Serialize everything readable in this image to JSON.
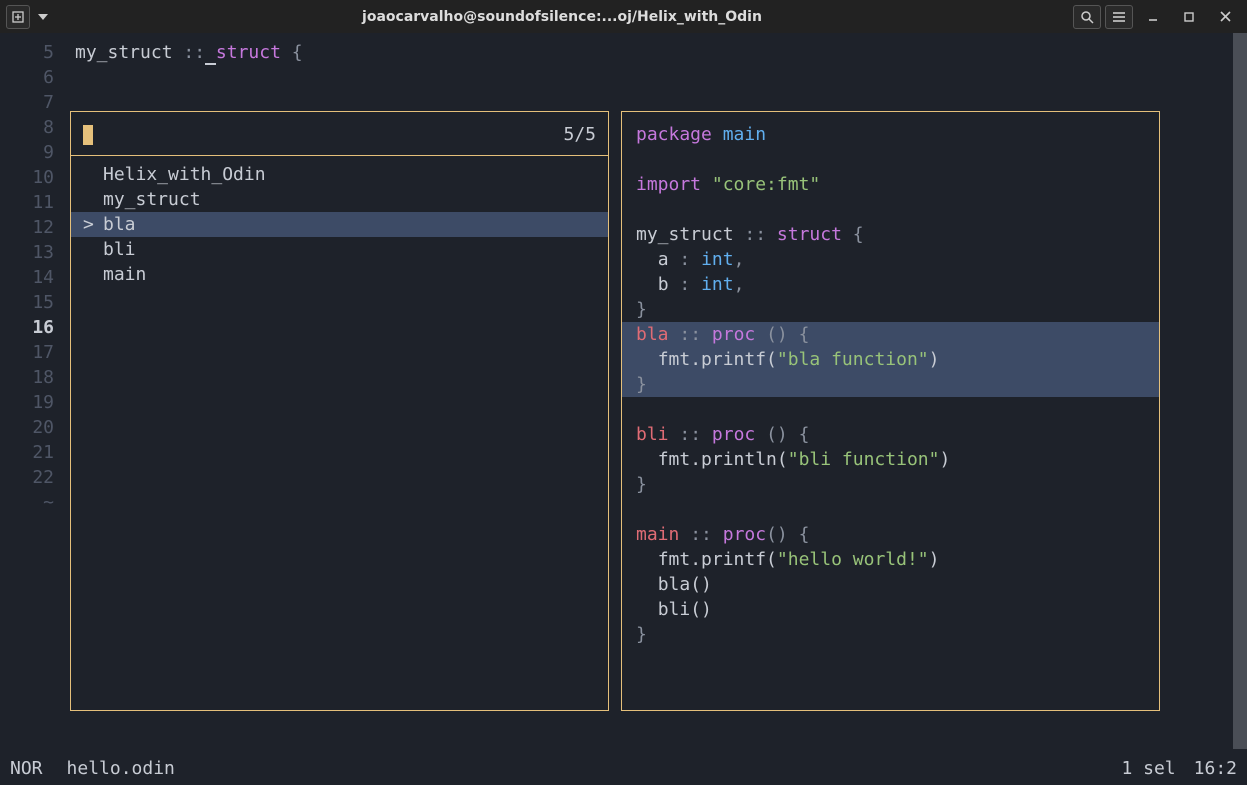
{
  "titlebar": {
    "title": "joaocarvalho@soundofsilence:...oj/Helix_with_Odin"
  },
  "gutter": {
    "lines": [
      "5",
      "6",
      "7",
      "8",
      "9",
      "10",
      "11",
      "12",
      "13",
      "14",
      "15",
      "16",
      "17",
      "18",
      "19",
      "20",
      "21",
      "22",
      "~"
    ],
    "current": "16"
  },
  "bgcode": {
    "ident": "my_struct",
    "sep": "::",
    "kw": "struct",
    "brace": "{"
  },
  "picker": {
    "count": "5/5",
    "items": [
      "Helix_with_Odin",
      "my_struct",
      "bla",
      "bli",
      "main"
    ],
    "selected": "bla"
  },
  "preview": {
    "package_kw": "package",
    "package_name": "main",
    "import_kw": "import",
    "import_str": "\"core:fmt\"",
    "struct_name": "my_struct",
    "struct_sep": "::",
    "struct_kw": "struct",
    "struct_open": "{",
    "fa": "a",
    "fcolon": ":",
    "fint": "int",
    "fcomma": ",",
    "fb": "b",
    "close": "}",
    "bla_name": "bla",
    "proc_kw": "proc",
    "paren": "()",
    "brace_open": "{",
    "bla_call": "fmt.printf(",
    "bla_str": "\"bla function\"",
    "bla_end": ")",
    "bli_name": "bli",
    "bli_call": "fmt.println(",
    "bli_str": "\"bli function\"",
    "bli_end": ")",
    "main_name": "main",
    "main_call": "fmt.printf(",
    "main_str": "\"hello world!\"",
    "main_end": ")",
    "call_bla": "bla()",
    "call_bli": "bli()"
  },
  "status": {
    "mode": "NOR",
    "file": "hello.odin",
    "sel": "1 sel",
    "pos": "16:2"
  }
}
